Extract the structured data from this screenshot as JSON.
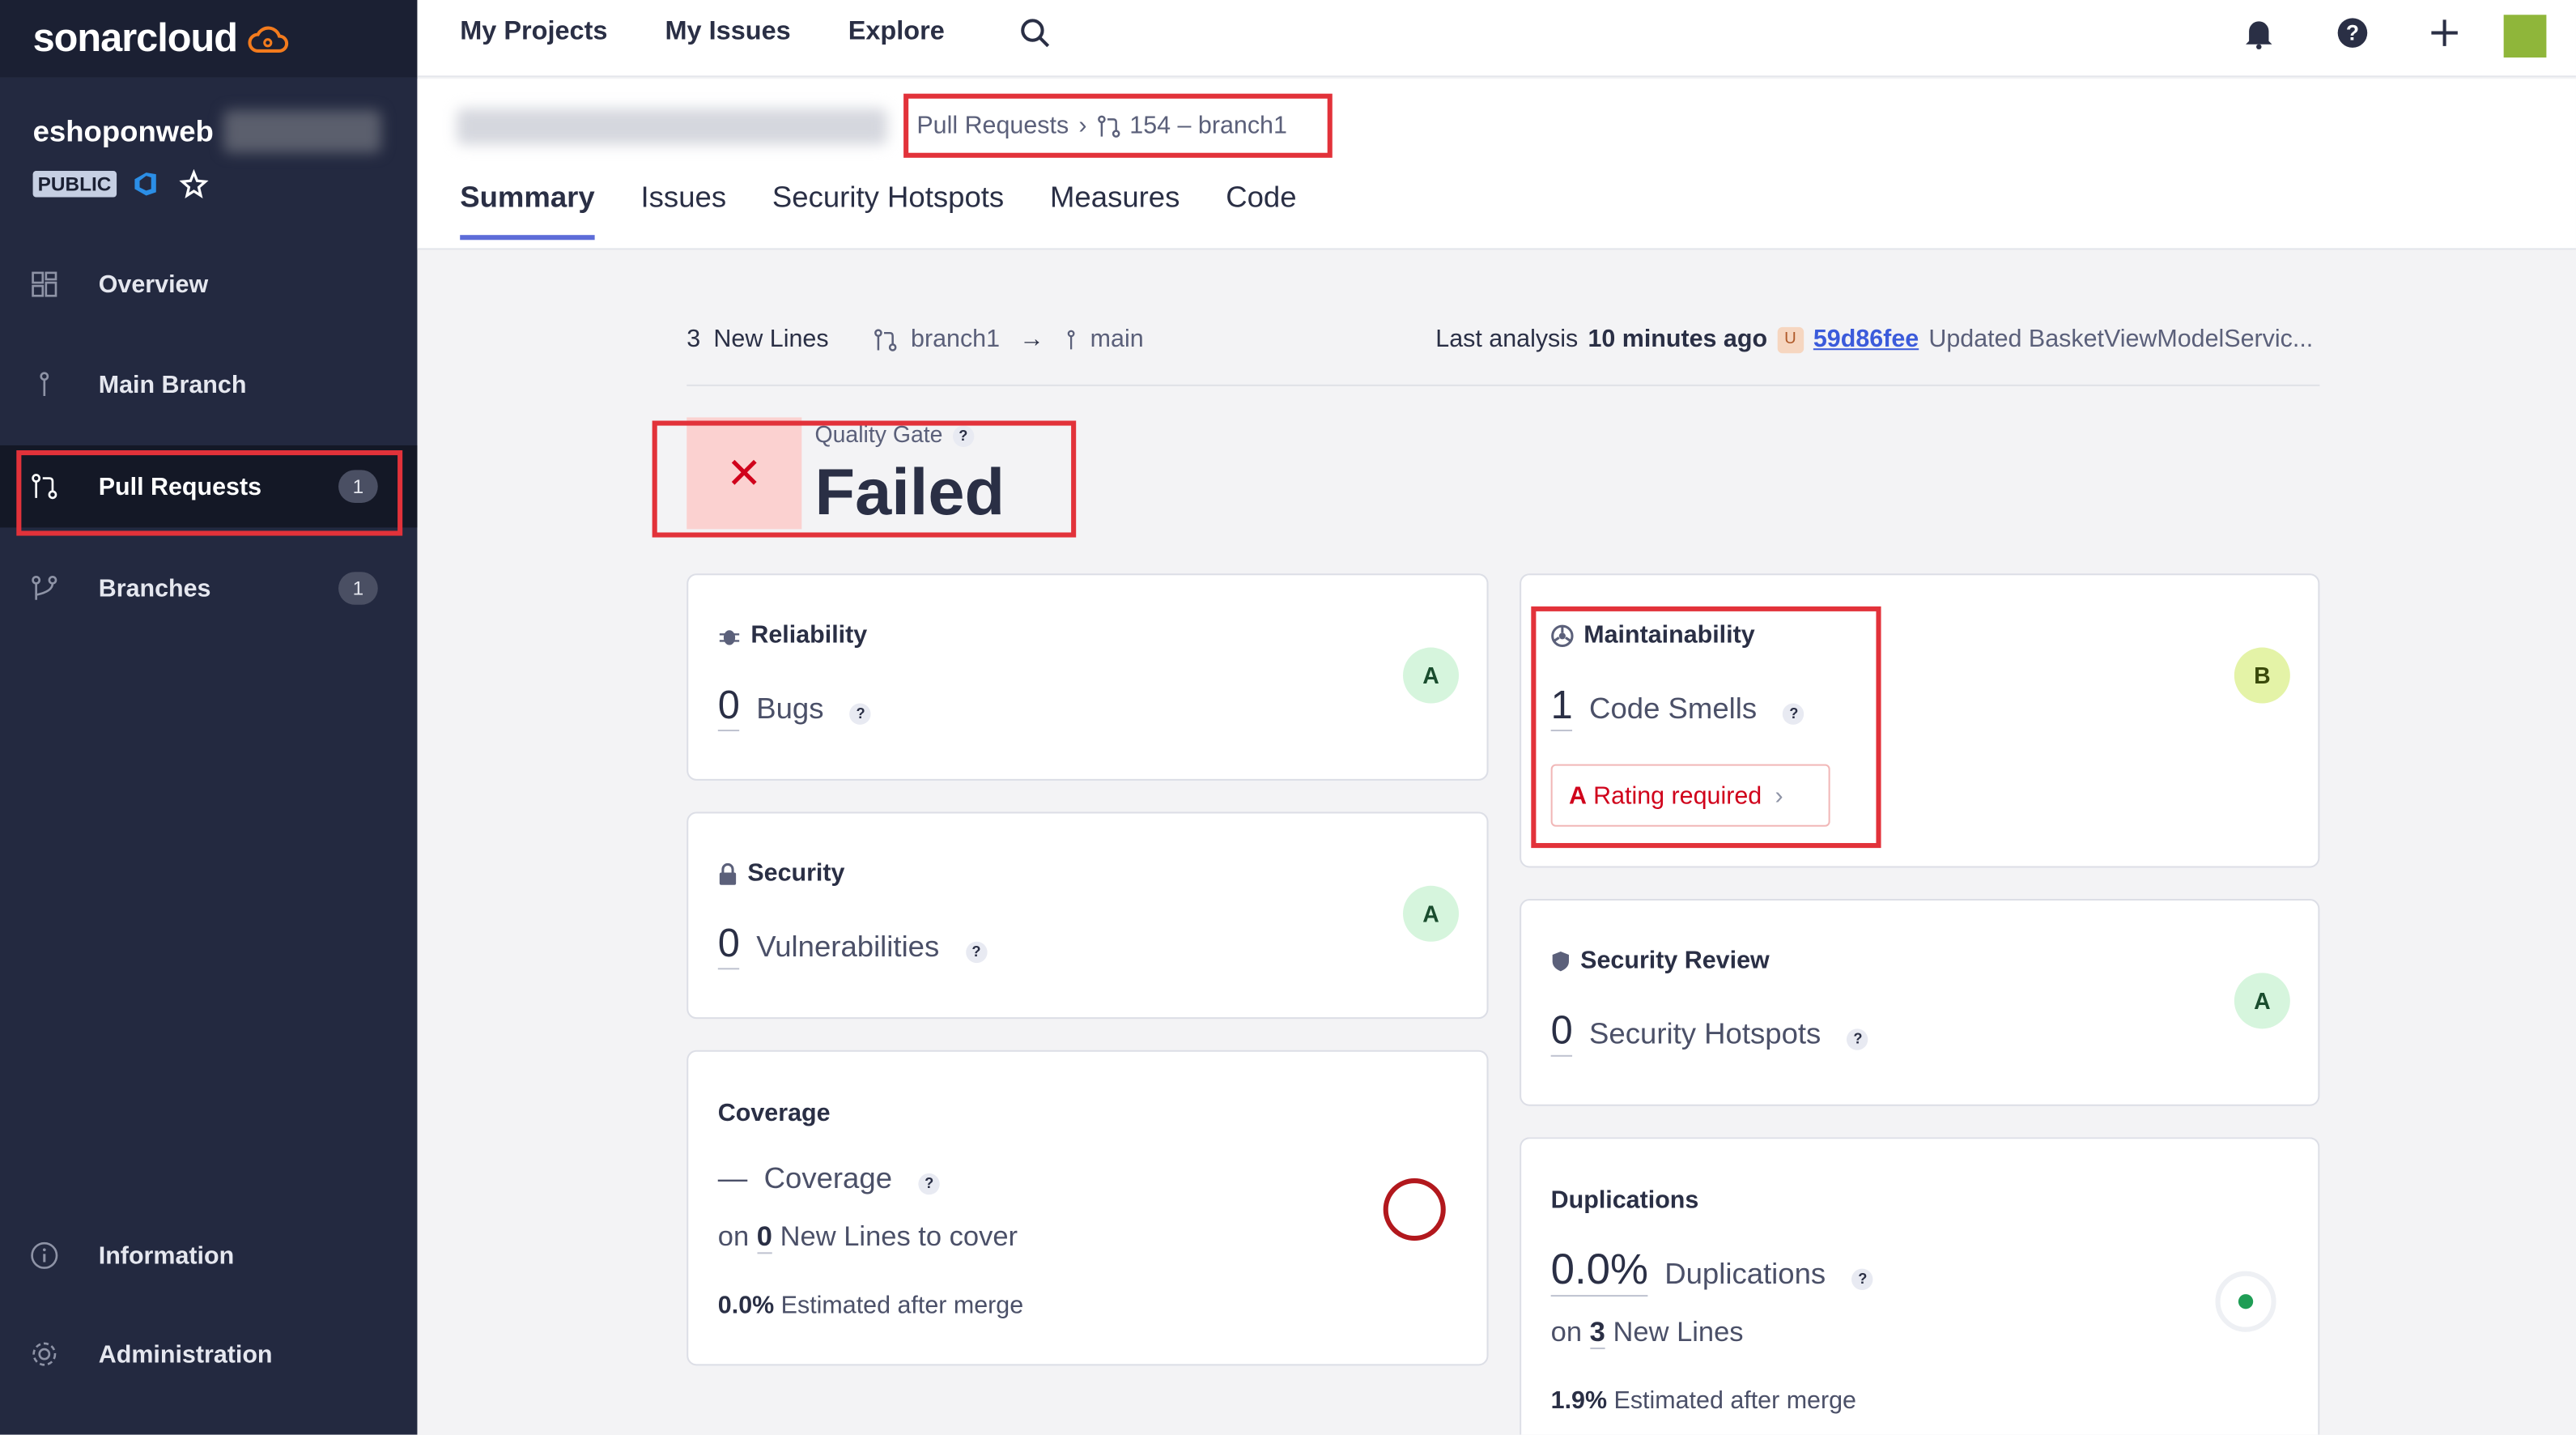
{
  "brand": {
    "name": "sonarcloud"
  },
  "project": {
    "name": "eshoponweb",
    "visibility": "PUBLIC"
  },
  "sidebar": {
    "items": [
      {
        "label": "Overview"
      },
      {
        "label": "Main Branch"
      },
      {
        "label": "Pull Requests",
        "count": "1"
      },
      {
        "label": "Branches",
        "count": "1"
      },
      {
        "label": "Information"
      },
      {
        "label": "Administration"
      }
    ]
  },
  "topnav": {
    "items": [
      "My Projects",
      "My Issues",
      "Explore"
    ]
  },
  "breadcrumb": {
    "section": "Pull Requests",
    "pr": "154 – branch1"
  },
  "tabs": [
    "Summary",
    "Issues",
    "Security Hotspots",
    "Measures",
    "Code"
  ],
  "info": {
    "new_lines_count": "3",
    "new_lines_label": "New Lines",
    "source_branch": "branch1",
    "target_branch": "main",
    "analysis_prefix": "Last analysis",
    "analysis_time": "10 minutes ago",
    "user_badge": "U",
    "commit_hash": "59d86fee",
    "commit_message": "Updated BasketViewModelServic..."
  },
  "quality_gate": {
    "label": "Quality Gate",
    "status": "Failed",
    "icon": "✕",
    "help": "?"
  },
  "cards": {
    "reliability": {
      "title": "Reliability",
      "value": "0",
      "label": "Bugs",
      "grade": "A"
    },
    "security": {
      "title": "Security",
      "value": "0",
      "label": "Vulnerabilities",
      "grade": "A"
    },
    "coverage": {
      "title": "Coverage",
      "value": "—",
      "label": "Coverage",
      "on_prefix": "on",
      "on_value": "0",
      "on_suffix": "New Lines to cover",
      "est_value": "0.0%",
      "est_label": "Estimated after merge"
    },
    "maintainability": {
      "title": "Maintainability",
      "value": "1",
      "label": "Code Smells",
      "grade": "B",
      "required_grade": "A",
      "required_label": "Rating required"
    },
    "security_review": {
      "title": "Security Review",
      "value": "0",
      "label": "Security Hotspots",
      "grade": "A"
    },
    "duplications": {
      "title": "Duplications",
      "value": "0.0%",
      "label": "Duplications",
      "on_prefix": "on",
      "on_value": "3",
      "on_suffix": "New Lines",
      "est_value": "1.9%",
      "est_label": "Estimated after merge"
    }
  },
  "colors": {
    "accent": "#5d6cd8",
    "error": "#d0021b",
    "sidebar": "#232940",
    "highlight": "#e2323a"
  }
}
